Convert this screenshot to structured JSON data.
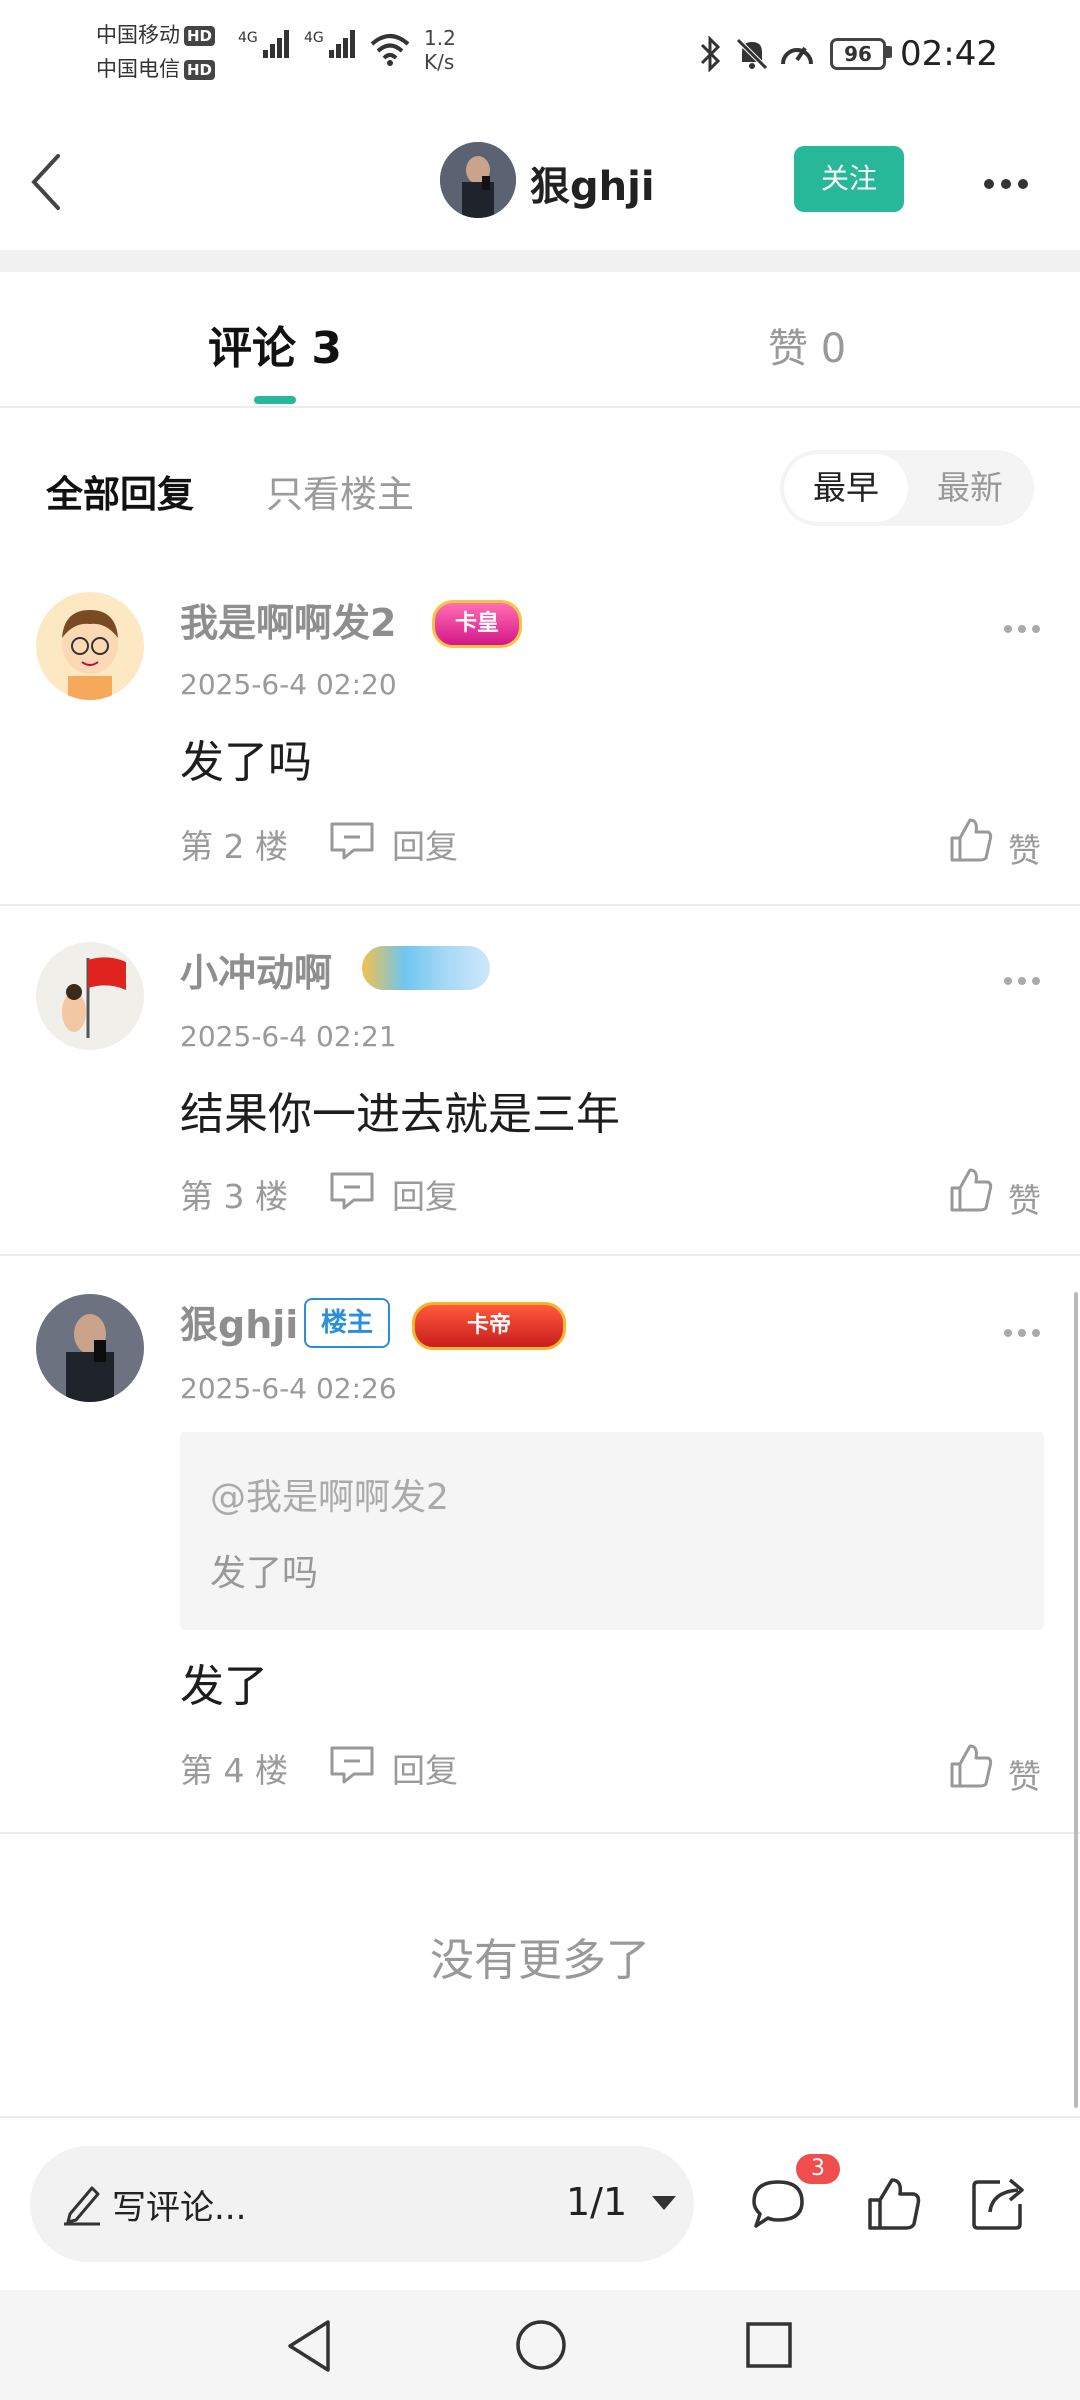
{
  "status_bar": {
    "carrier1": "中国移动",
    "carrier2": "中国电信",
    "hd": "HD",
    "net1": "4G",
    "net2": "4G",
    "speed_value": "1.2",
    "speed_unit": "K/s",
    "battery": "96",
    "time": "02:42"
  },
  "header": {
    "username": "狠ghji",
    "follow_label": "关注"
  },
  "tabs": {
    "comments_label": "评论 3",
    "likes_label": "赞 0"
  },
  "filters": {
    "all": "全部回复",
    "owner_only": "只看楼主",
    "earliest": "最早",
    "latest": "最新"
  },
  "comments": [
    {
      "name": "我是啊啊发2",
      "badge": "卡皇",
      "time": "2025-6-4 02:20",
      "text": "发了吗",
      "floor": "第 2 楼",
      "reply": "回复",
      "like": "赞"
    },
    {
      "name": "小冲动啊",
      "time": "2025-6-4 02:21",
      "text": "结果你一进去就是三年",
      "floor": "第 3 楼",
      "reply": "回复",
      "like": "赞"
    },
    {
      "name": "狠ghji",
      "owner_tag": "楼主",
      "badge": "卡帝",
      "time": "2025-6-4 02:26",
      "quote_at": "@我是啊啊发2",
      "quote_text": "发了吗",
      "text": "发了",
      "floor": "第 4 楼",
      "reply": "回复",
      "like": "赞"
    }
  ],
  "no_more": "没有更多了",
  "bottom_bar": {
    "write_placeholder": "写评论...",
    "page": "1/1",
    "comment_count": "3"
  },
  "colors": {
    "accent": "#27b89a",
    "owner_blue": "#2a8ede",
    "badge_red": "#f04e4e"
  }
}
